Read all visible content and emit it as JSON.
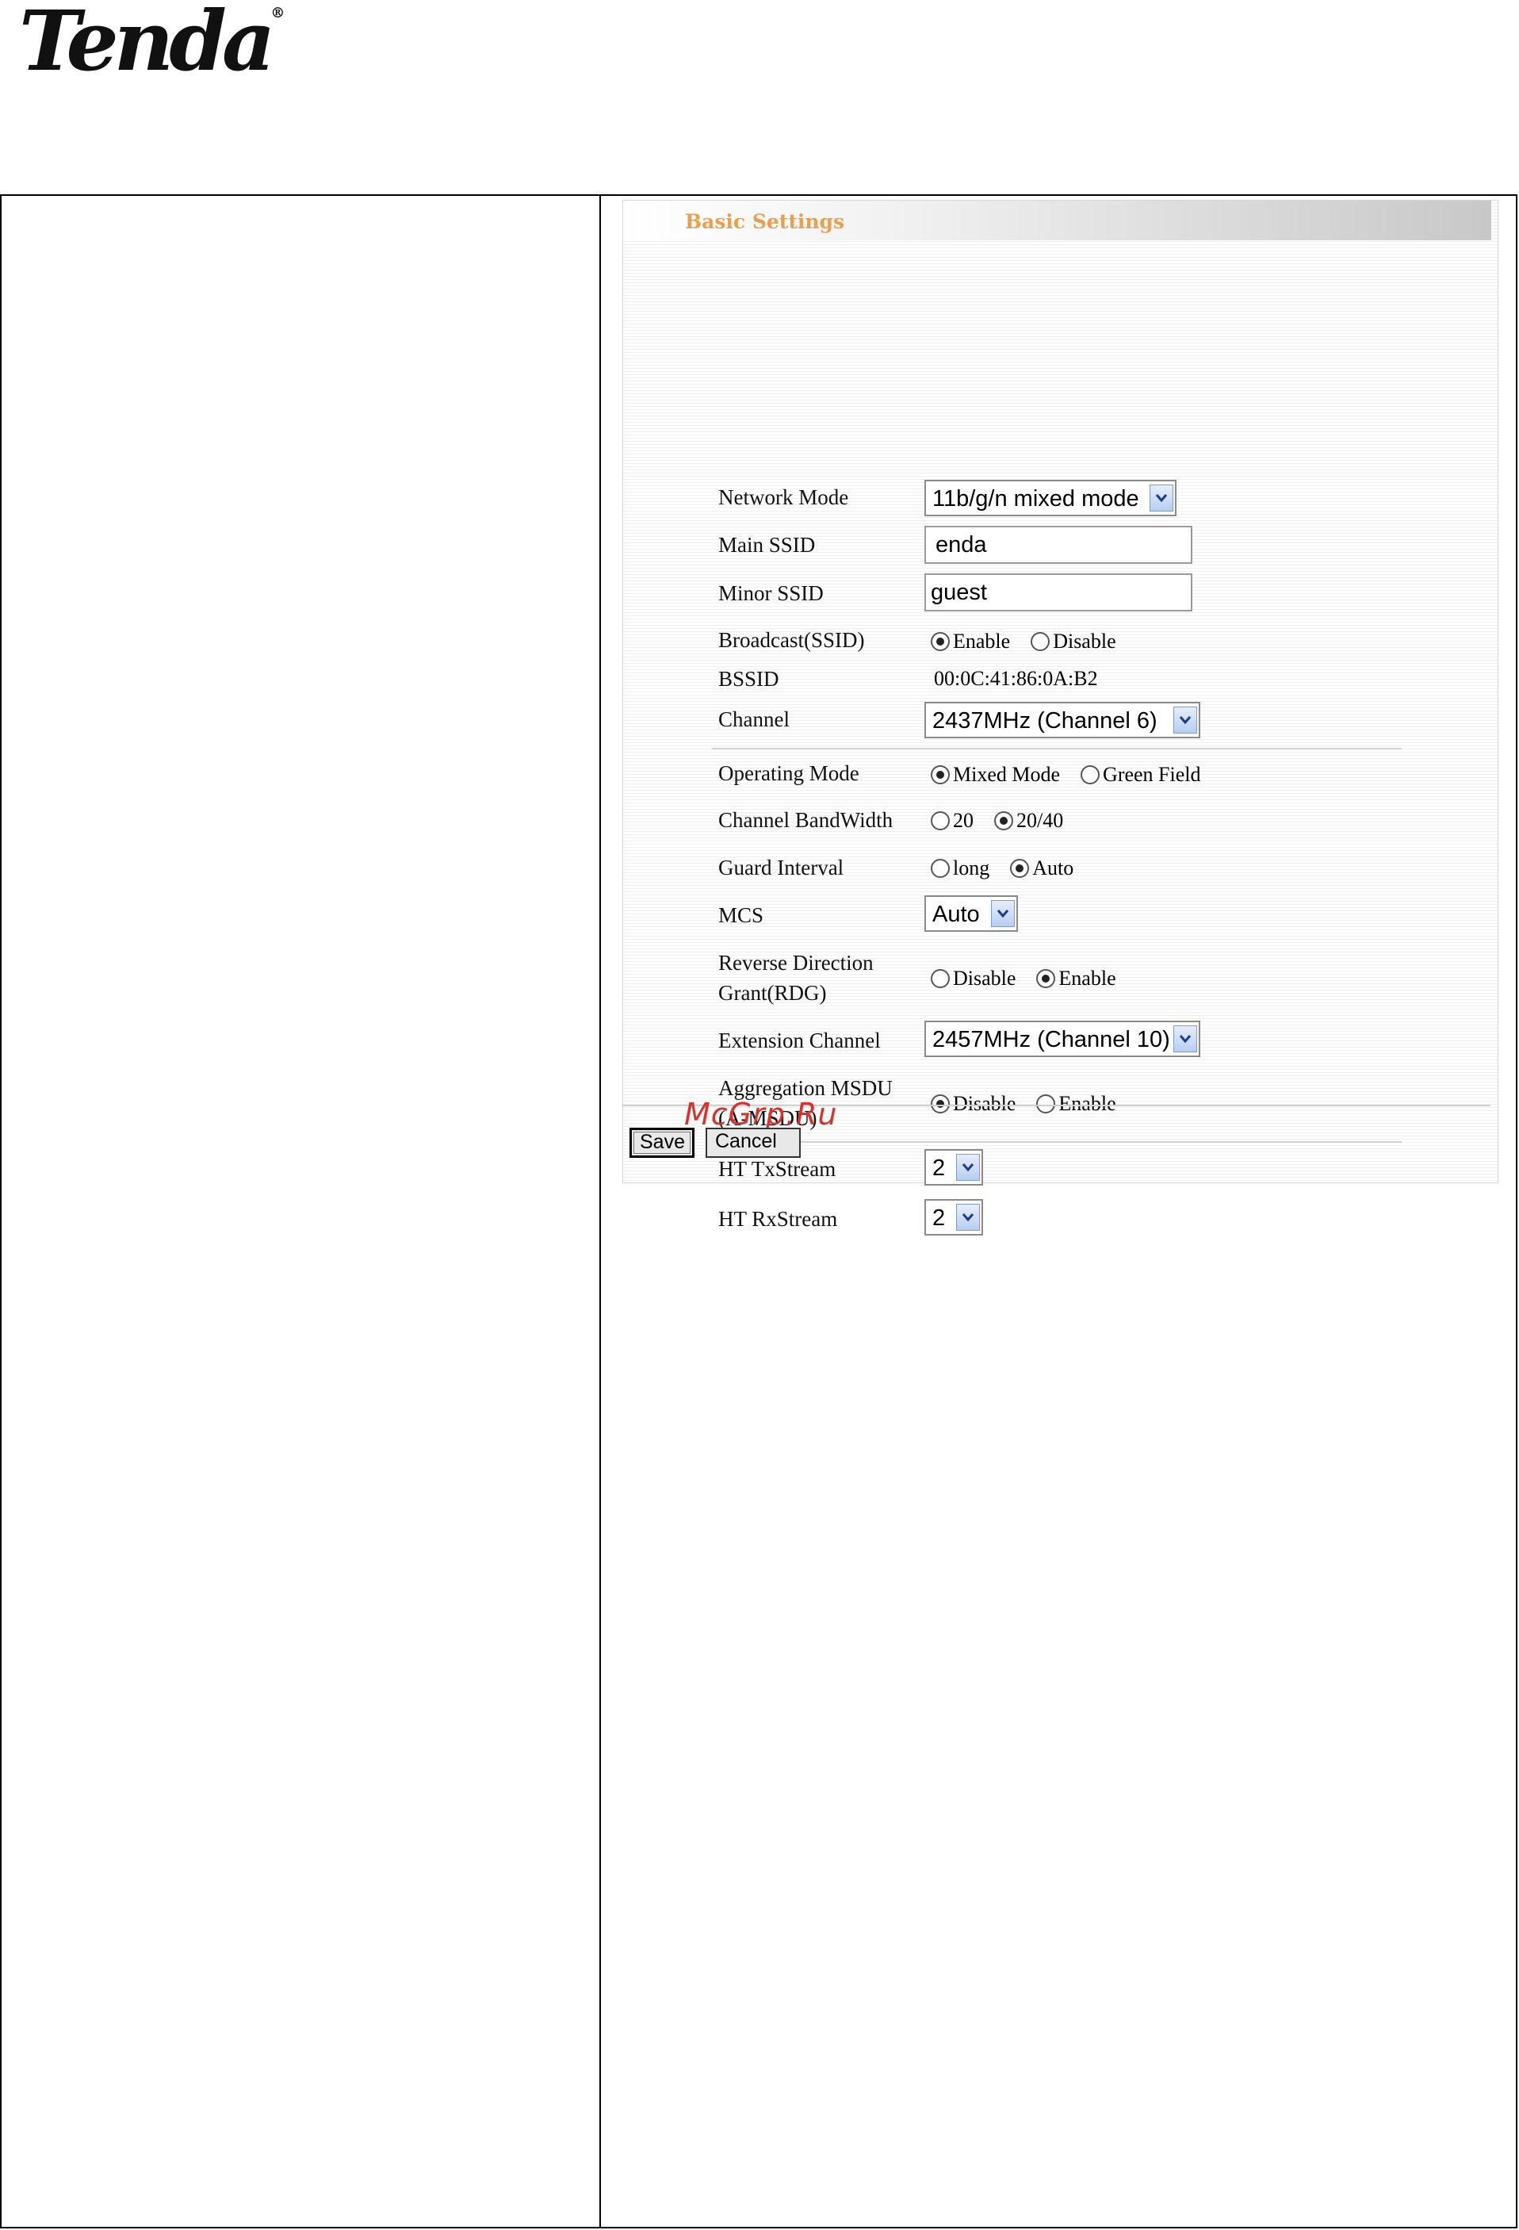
{
  "brand": {
    "logo_text": "Tenda",
    "logo_mark": "®"
  },
  "panel": {
    "title": "Basic Settings"
  },
  "fields": {
    "network_mode": {
      "label": "Network Mode",
      "value": "11b/g/n mixed mode"
    },
    "main_ssid": {
      "label": "Main SSID",
      "value": "enda"
    },
    "minor_ssid": {
      "label": "Minor SSID",
      "value": "guest"
    },
    "broadcast": {
      "label": "Broadcast(SSID)",
      "opt1": "Enable",
      "opt2": "Disable",
      "selected": "Enable"
    },
    "bssid": {
      "label": "BSSID",
      "value": "00:0C:41:86:0A:B2"
    },
    "channel": {
      "label": "Channel",
      "value": "2437MHz (Channel 6)"
    },
    "operating_mode": {
      "label": "Operating Mode",
      "opt1": "Mixed Mode",
      "opt2": "Green Field",
      "selected": "Mixed Mode"
    },
    "channel_bandwidth": {
      "label": "Channel BandWidth",
      "opt1": "20",
      "opt2": "20/40",
      "selected": "20/40"
    },
    "guard_interval": {
      "label": "Guard Interval",
      "opt1": "long",
      "opt2": "Auto",
      "selected": "Auto"
    },
    "mcs": {
      "label": "MCS",
      "value": "Auto"
    },
    "rdg": {
      "label_line1": "Reverse Direction",
      "label_line2": "Grant(RDG)",
      "opt1": "Disable",
      "opt2": "Enable",
      "selected": "Enable"
    },
    "extension_channel": {
      "label": "Extension Channel",
      "value": "2457MHz (Channel 10)"
    },
    "amsdu": {
      "label_line1": "Aggregation MSDU",
      "label_line2": "(A-MSDU)",
      "opt1": "Disable",
      "opt2": "Enable",
      "selected": "Disable"
    },
    "ht_txstream": {
      "label": "HT TxStream",
      "value": "2"
    },
    "ht_rxstream": {
      "label": "HT RxStream",
      "value": "2"
    }
  },
  "buttons": {
    "save": "Save",
    "cancel": "Cancel"
  },
  "watermark": "McGrp.Ru",
  "colors": {
    "title": "#e8a050",
    "watermark": "#d8322a",
    "select_arrow": "#b9cdf2"
  }
}
